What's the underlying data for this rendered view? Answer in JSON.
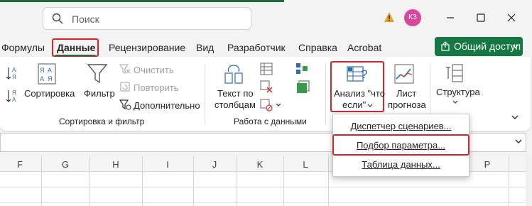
{
  "search": {
    "placeholder": "Поиск"
  },
  "user": {
    "initials": "КЗ"
  },
  "tabs": [
    {
      "label": "Формулы"
    },
    {
      "label": "Данные"
    },
    {
      "label": "Рецензирование"
    },
    {
      "label": "Вид"
    },
    {
      "label": "Разработчик"
    },
    {
      "label": "Справка"
    },
    {
      "label": "Acrobat"
    }
  ],
  "share": {
    "label": "Общий доступ"
  },
  "ribbon": {
    "sort_label": "Сортировка",
    "filter_label": "Фильтр",
    "clear_label": "Очистить",
    "reapply_label": "Повторить",
    "advanced_label": "Дополнительно",
    "sort_filter_group": "Сортировка и фильтр",
    "text_to_columns_line1": "Текст по",
    "text_to_columns_line2": "столбцам",
    "data_tools_group": "Работа с данными",
    "whatif_line1": "Анализ \"что",
    "whatif_line2": "если\"",
    "forecast_line1": "Лист",
    "forecast_line2": "прогноза",
    "outline_label": "Структура"
  },
  "menu": {
    "items": [
      {
        "label": "Диспетчер сценариев..."
      },
      {
        "label": "Подбор параметра..."
      },
      {
        "label": "Таблица данных..."
      }
    ]
  },
  "columns": [
    "F",
    "G",
    "H",
    "I",
    "J",
    "K",
    "L",
    "P"
  ],
  "colors": {
    "accent_green": "#157742",
    "highlight_red": "#d9232b"
  }
}
